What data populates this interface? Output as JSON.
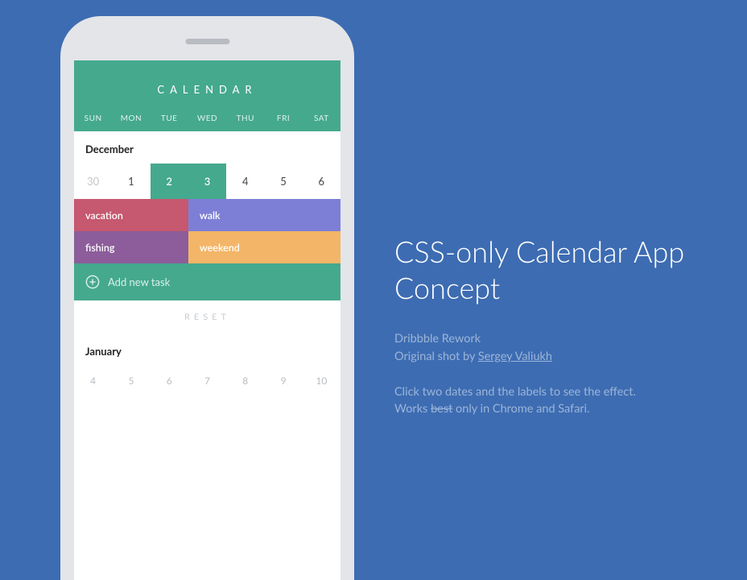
{
  "header": {
    "title": "CALENDAR",
    "weekdays": [
      "SUN",
      "MON",
      "TUE",
      "WED",
      "THU",
      "FRI",
      "SAT"
    ]
  },
  "months": {
    "dec": {
      "label": "December",
      "row1": [
        "30",
        "1",
        "2",
        "3",
        "4",
        "5",
        "6"
      ]
    },
    "jan": {
      "label": "January",
      "row1": [
        "4",
        "5",
        "6",
        "7",
        "8",
        "9",
        "10"
      ]
    }
  },
  "tasks": {
    "vacation": "vacation",
    "walk": "walk",
    "fishing": "fishing",
    "weekend": "weekend"
  },
  "add_task_label": "Add new task",
  "reset_label": "RESET",
  "copy": {
    "heading": "CSS-only Calendar App Concept",
    "meta_line1": "Dribbble Rework",
    "meta_line2_prefix": "Original shot by ",
    "meta_author": "Sergey Valiukh",
    "hint_line1": "Click two dates and the labels to see the effect.",
    "hint_line2_a": "Works ",
    "hint_line2_strike": "best",
    "hint_line2_b": " only in Chrome and Safari."
  }
}
